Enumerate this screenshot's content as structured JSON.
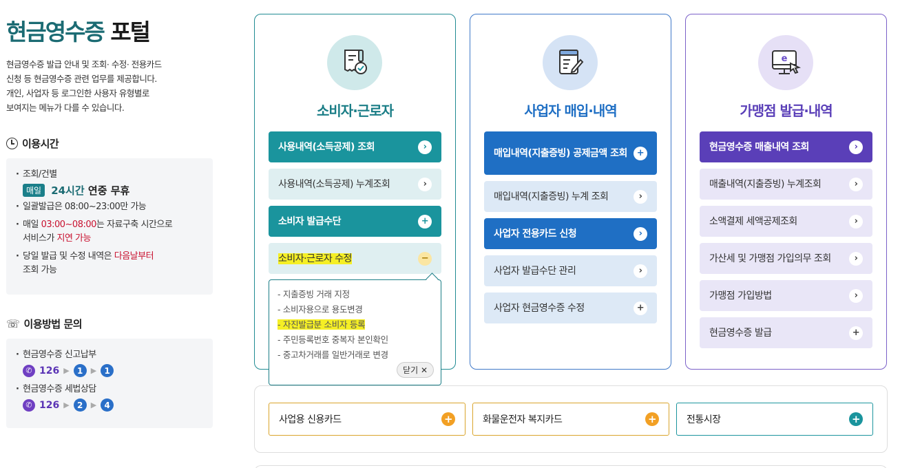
{
  "portal": {
    "title_accent": "현금영수증",
    "title_rest": "포털",
    "description": [
      "현금영수증 발급 안내 및 조회· 수정· 전용카드",
      "신청 등 현금영수증 관련 업무를 제공합니다.",
      "개인, 사업자 등 로그인한 사용자 유형별로",
      "보여지는 메뉴가 다를 수 있습니다."
    ]
  },
  "hours": {
    "heading": "이용시간",
    "inquiry_label": "조회/건별",
    "badge": "매일",
    "always_hours": "24시간",
    "always_rest": "연중 무휴",
    "batch": "일괄발급은 08:00~23:00만 가능",
    "maint_prefix": "매일 ",
    "maint_time": "03:00~08:00",
    "maint_mid": "는 자료구축 시간으로",
    "maint_line2_prefix": "서비스가 ",
    "maint_delay": "지연 가능",
    "sameday_prefix": "당일 발급 및 수정 내역은 ",
    "sameday_next": "다음날부터",
    "sameday_line2": "조회 가능"
  },
  "contact": {
    "heading": "이용방법 문의",
    "items": [
      {
        "label": "현금영수증 신고납부",
        "num": "126",
        "d1": "1",
        "d2": "1"
      },
      {
        "label": "현금영수증 세법상담",
        "num": "126",
        "d1": "2",
        "d2": "4"
      }
    ]
  },
  "cards": [
    {
      "title": "소비자·근로자",
      "title_color": "#1a7d86",
      "buttons": [
        {
          "label": "사용내역(소득공제) 조회",
          "style": "dark",
          "glyph": "›"
        },
        {
          "label": "사용내역(소득공제) 누계조회",
          "style": "light",
          "glyph": "›"
        },
        {
          "label": "소비자 발급수단",
          "style": "dark",
          "glyph": "+"
        },
        {
          "label": "소비자·근로자 수정",
          "style": "light",
          "glyph": "−"
        }
      ],
      "popup": {
        "items": [
          "- 지출증빙 거래 지정",
          "- 소비자용으로 용도변경",
          "- 자진발급분 소비자 등록",
          "- 주민등록번호 중복자 본인확인",
          "- 중고차거래를 일반거래로 변경"
        ],
        "close": "닫기 ✕"
      }
    },
    {
      "title": "사업자 매입·내역",
      "title_color": "#1f6fc4",
      "buttons": [
        {
          "label": "매입내역(지출증빙) 공제금액 조회",
          "style": "dark",
          "glyph": "+"
        },
        {
          "label": "매입내역(지출증빙) 누계 조회",
          "style": "light",
          "glyph": "›"
        },
        {
          "label": "사업자 전용카드 신청",
          "style": "dark",
          "glyph": "›"
        },
        {
          "label": "사업자 발급수단 관리",
          "style": "light",
          "glyph": "›"
        },
        {
          "label": "사업자 현금영수증 수정",
          "style": "light",
          "glyph": "+"
        }
      ]
    },
    {
      "title": "가맹점 발급·내역",
      "title_color": "#5a3fb8",
      "buttons": [
        {
          "label": "현금영수증 매출내역 조회",
          "style": "dark",
          "glyph": "›"
        },
        {
          "label": "매출내역(지출증빙) 누계조회",
          "style": "light",
          "glyph": "›"
        },
        {
          "label": "소액결제 세액공제조회",
          "style": "light",
          "glyph": "›"
        },
        {
          "label": "가산세 및 가맹점 가입의무 조회",
          "style": "light",
          "glyph": "›"
        },
        {
          "label": "가맹점 가입방법",
          "style": "light",
          "glyph": "›"
        },
        {
          "label": "현금영수증 발급",
          "style": "light",
          "glyph": "+"
        }
      ]
    }
  ],
  "bottom": [
    {
      "label": "사업용 신용카드",
      "color": "#f2a024",
      "glyph": "+"
    },
    {
      "label": "화물운전자 복지카드",
      "color": "#f2a024",
      "glyph": "+"
    },
    {
      "label": "전통시장",
      "color": "#1a949d",
      "glyph": "+"
    }
  ]
}
